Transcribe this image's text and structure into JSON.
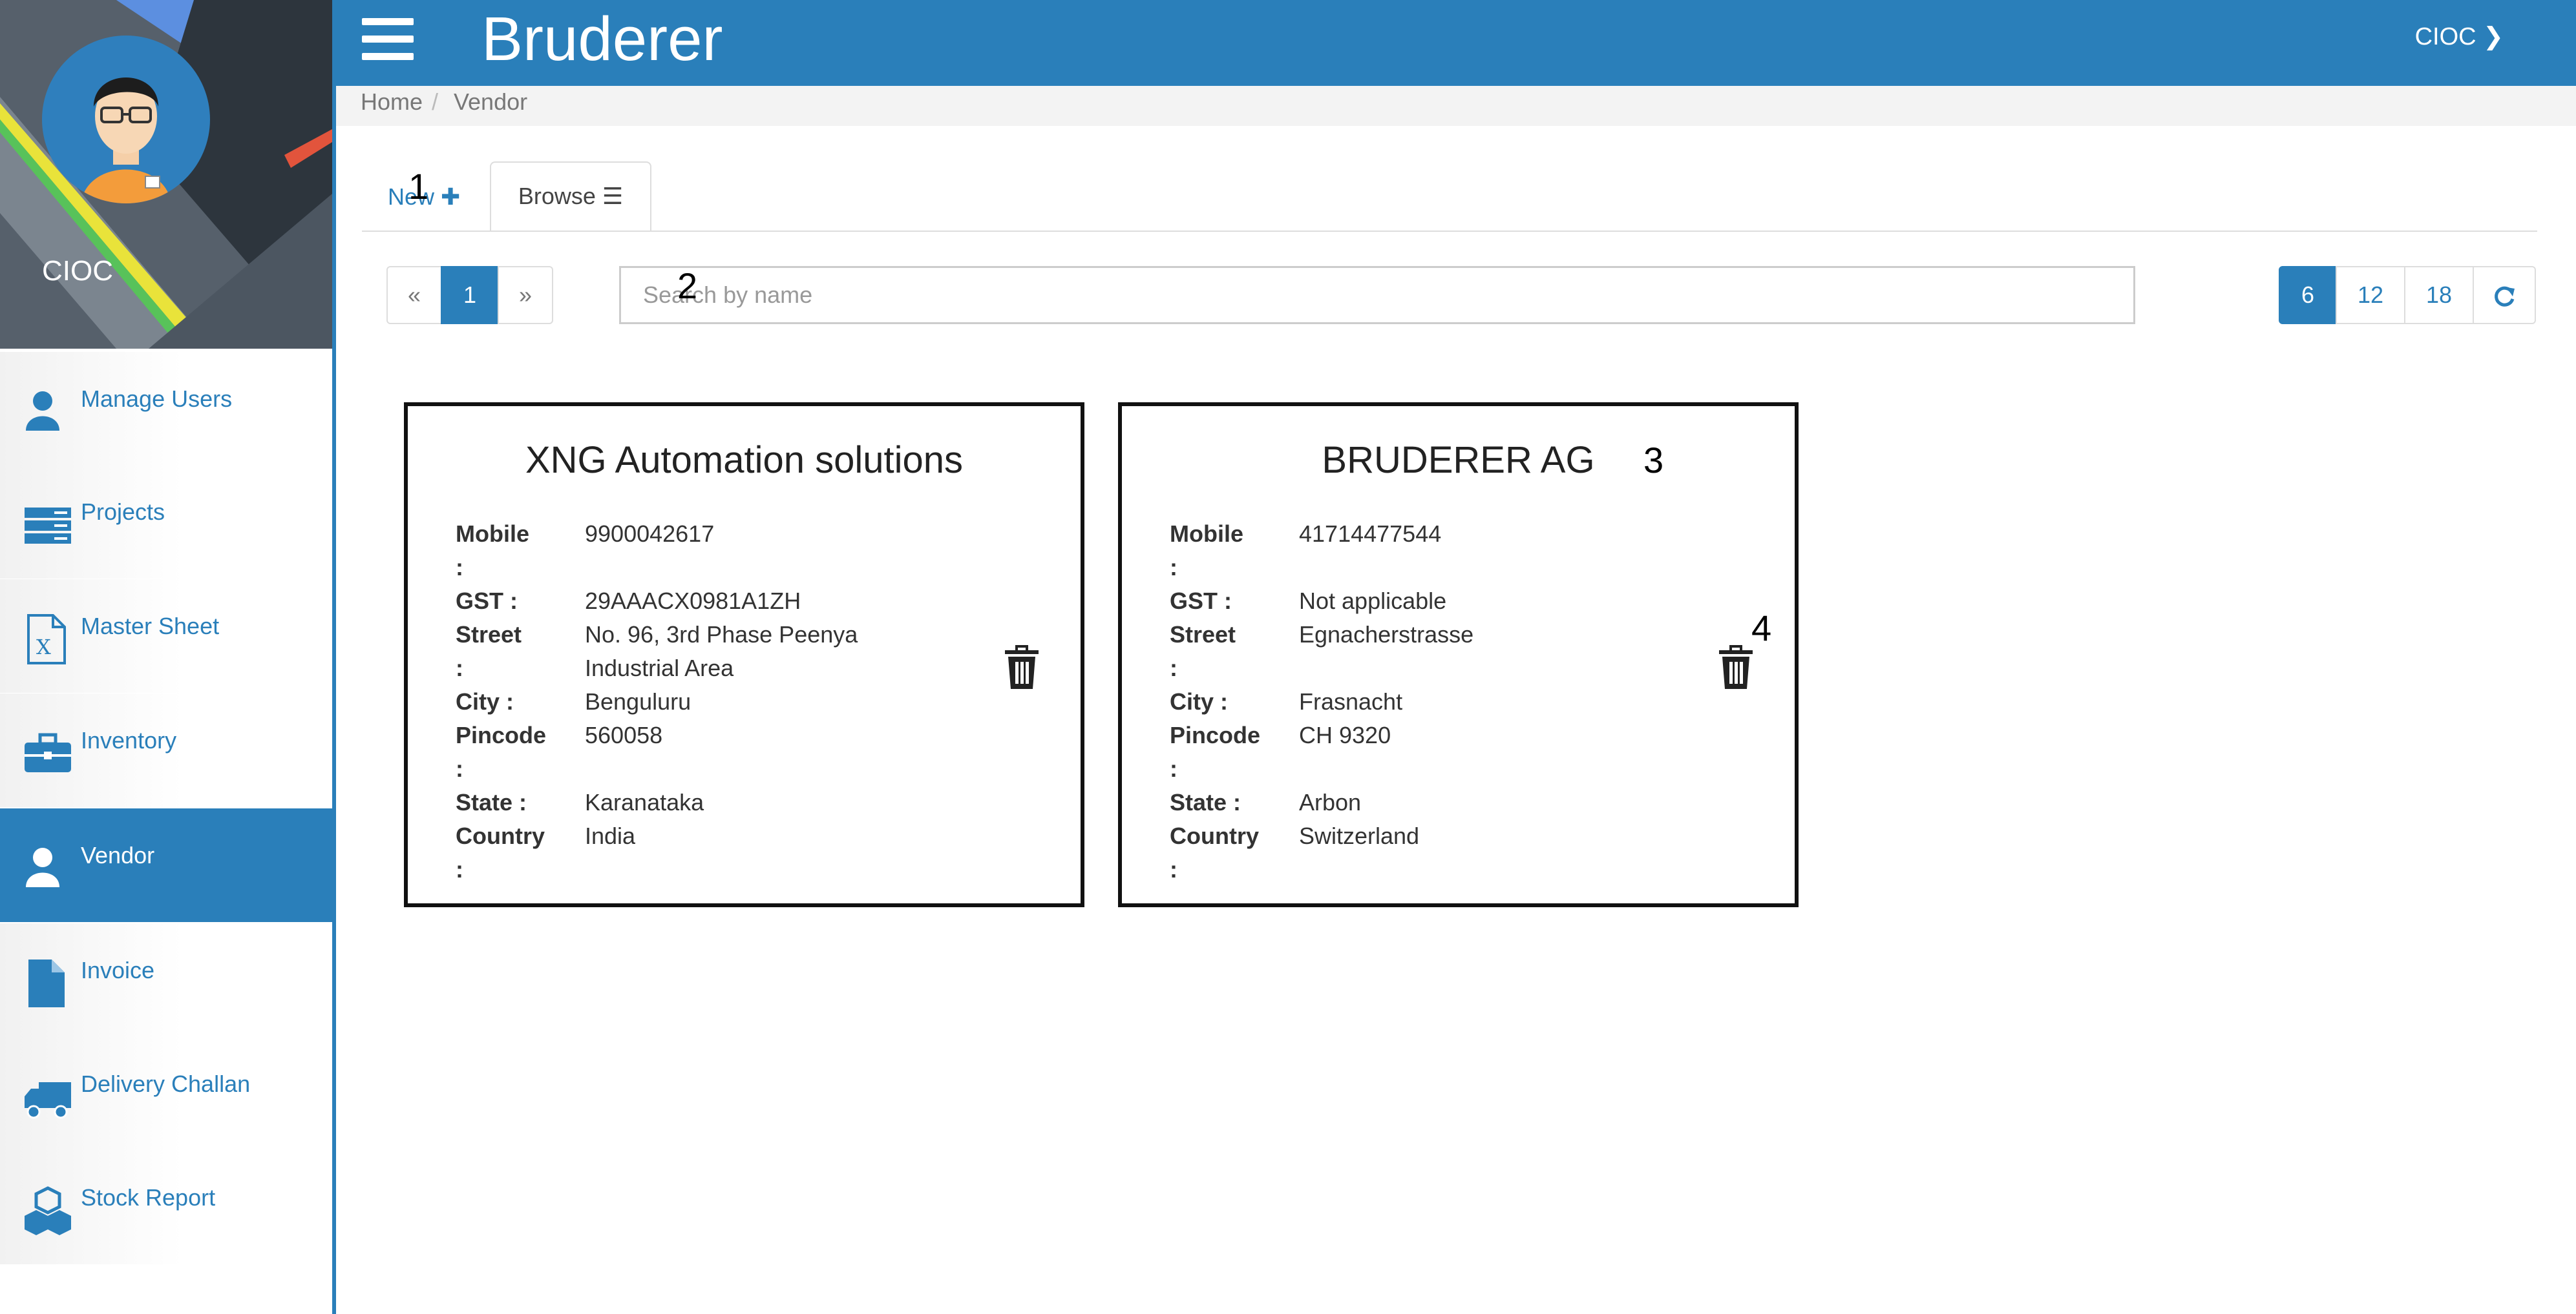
{
  "app": {
    "title": "Bruderer",
    "user_menu": "CIOC ❯"
  },
  "profile": {
    "name": "CIOC"
  },
  "sidebar": {
    "items": [
      {
        "label": "Manage Users",
        "icon": "user-icon"
      },
      {
        "label": "Projects",
        "icon": "server-icon"
      },
      {
        "label": "Master Sheet",
        "icon": "excel-file-icon"
      },
      {
        "label": "Inventory",
        "icon": "briefcase-icon"
      },
      {
        "label": "Vendor",
        "icon": "user-icon",
        "active": true
      },
      {
        "label": "Invoice",
        "icon": "file-icon"
      },
      {
        "label": "Delivery Challan",
        "icon": "truck-icon"
      },
      {
        "label": "Stock Report",
        "icon": "cubes-icon"
      }
    ]
  },
  "breadcrumb": {
    "home": "Home",
    "sep": "/",
    "current": "Vendor"
  },
  "tabs": {
    "new_label": "New ✚",
    "browse_label": "Browse ☰"
  },
  "pagination": {
    "prev": "«",
    "current": "1",
    "next": "»"
  },
  "search": {
    "placeholder": "Search by name"
  },
  "page_size": {
    "options": [
      "6",
      "12",
      "18"
    ],
    "selected": "6",
    "refresh_icon": "refresh-icon"
  },
  "vendors": [
    {
      "name": "XNG Automation solutions",
      "fields": [
        {
          "k": "Mobile",
          "colon": ":",
          "v": "9900042617"
        },
        {
          "k": "GST :",
          "v": "29AAACX0981A1ZH"
        },
        {
          "k": "Street",
          "colon": ":",
          "v": "No. 96, 3rd Phase Peenya",
          "v2": "Industrial Area"
        },
        {
          "k": "City :",
          "v": "Benguluru"
        },
        {
          "k": "Pincode",
          "colon": ":",
          "v": "560058"
        },
        {
          "k": "State :",
          "v": "Karanataka"
        },
        {
          "k": "Country",
          "colon": ":",
          "v": "India"
        }
      ]
    },
    {
      "name": "BRUDERER AG",
      "fields": [
        {
          "k": "Mobile",
          "colon": ":",
          "v": "41714477544"
        },
        {
          "k": "GST :",
          "v": "Not applicable"
        },
        {
          "k": "Street",
          "colon": ":",
          "v": "Egnacherstrasse"
        },
        {
          "k": "City :",
          "v": "Frasnacht"
        },
        {
          "k": "Pincode",
          "colon": ":",
          "v": "CH 9320"
        },
        {
          "k": "State :",
          "v": "Arbon"
        },
        {
          "k": "Country",
          "colon": ":",
          "v": "Switzerland"
        }
      ]
    }
  ],
  "markers": [
    "1",
    "2",
    "3",
    "4"
  ],
  "colors": {
    "primary": "#2a7fba",
    "header_text": "#ffffff"
  }
}
